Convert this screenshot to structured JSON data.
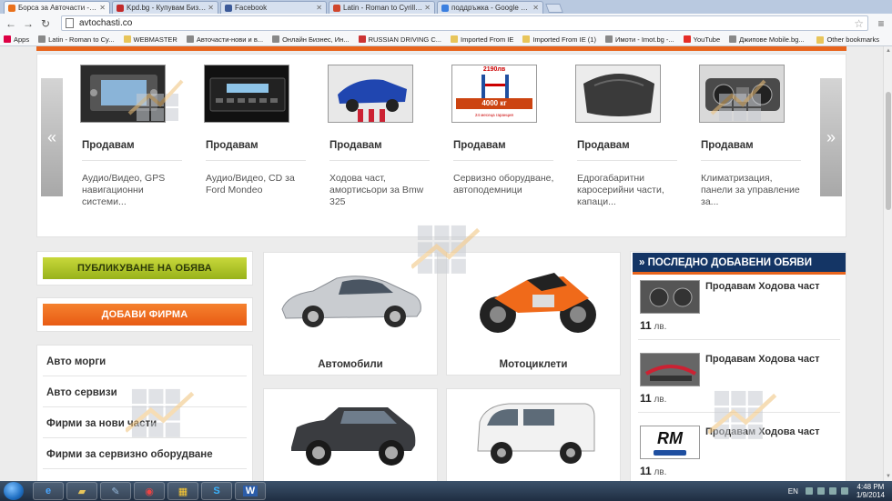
{
  "browser": {
    "tabs": [
      {
        "title": "Борса за Авточасти - Avt",
        "color": "#e9711c",
        "active": true
      },
      {
        "title": "Kpd.bg - Купувам Бизнес",
        "color": "#c22a2a",
        "active": false
      },
      {
        "title": "Facebook",
        "color": "#3b5998",
        "active": false
      },
      {
        "title": "Latin - Roman to Cyrillic a",
        "color": "#d0462c",
        "active": false
      },
      {
        "title": "поддръжка - Google Търс",
        "color": "#3a7fe0",
        "active": false
      }
    ],
    "url": "avtochasti.co",
    "bookmarks": [
      {
        "label": "Apps",
        "icon": "apps-icon"
      },
      {
        "label": "Latin - Roman to Cy...",
        "icon": "site-icon"
      },
      {
        "label": "WEBMASTER",
        "icon": "folder-icon"
      },
      {
        "label": "Авточасти-нови и в...",
        "icon": "site-icon"
      },
      {
        "label": "Онлайн Бизнес, Ин...",
        "icon": "site-icon"
      },
      {
        "label": "RUSSIAN DRIVING C...",
        "icon": "site-icon"
      },
      {
        "label": "Imported From IE",
        "icon": "folder-icon"
      },
      {
        "label": "Imported From IE (1)",
        "icon": "folder-icon"
      },
      {
        "label": "Имоти - Imot.bg -...",
        "icon": "site-icon"
      },
      {
        "label": "YouTube",
        "icon": "youtube-icon"
      },
      {
        "label": "Джипове Mobile.bg...",
        "icon": "site-icon"
      }
    ],
    "other_bookmarks": "Other bookmarks"
  },
  "carousel": {
    "prev": "«",
    "next": "»",
    "items": [
      {
        "title": "Продавам",
        "desc": "Аудио/Видео, GPS навигационни системи..."
      },
      {
        "title": "Продавам",
        "desc": "Аудио/Видео, CD за Ford Mondeo"
      },
      {
        "title": "Продавам",
        "desc": "Ходова част, амортисьори за Bmw 325"
      },
      {
        "title": "Продавам",
        "desc": "Сервизно оборудване, автоподемници",
        "img_text": {
          "top": "2190лв",
          "big": "4000 кг",
          "bottom": "24 месеца гаранция"
        }
      },
      {
        "title": "Продавам",
        "desc": "Едрогабаритни каросерийни части, капаци..."
      },
      {
        "title": "Продавам",
        "desc": "Климатризация, панели за управление за..."
      }
    ]
  },
  "left": {
    "publish_label": "ПУБЛИКУВАНЕ НА ОБЯВА",
    "company_label": "ДОБАВИ ФИРМА",
    "menu": [
      "Авто морги",
      "Авто сервизи",
      "Фирми за нови части",
      "Фирми за сервизно оборудване"
    ]
  },
  "categories": [
    {
      "label": "Автомобили"
    },
    {
      "label": "Мотоциклети"
    },
    {
      "label": ""
    },
    {
      "label": ""
    }
  ],
  "recent": {
    "heading": "» ПОСЛЕДНО ДОБАВЕНИ ОБЯВИ",
    "items": [
      {
        "title": "Продавам Ходова част",
        "price": "11",
        "currency": "лв."
      },
      {
        "title": "Продавам Ходова част",
        "price": "11",
        "currency": "лв."
      },
      {
        "title": "Продавам Ходова част",
        "price": "11",
        "currency": "лв.",
        "logo": "RM"
      }
    ]
  },
  "taskbar": {
    "lang": "EN",
    "time": "4:48 PM",
    "date": "1/9/2014",
    "apps": [
      "ie-icon",
      "explorer-icon",
      "paint-icon",
      "chrome-icon",
      "apps-grid-icon",
      "skype-icon",
      "word-icon"
    ]
  }
}
